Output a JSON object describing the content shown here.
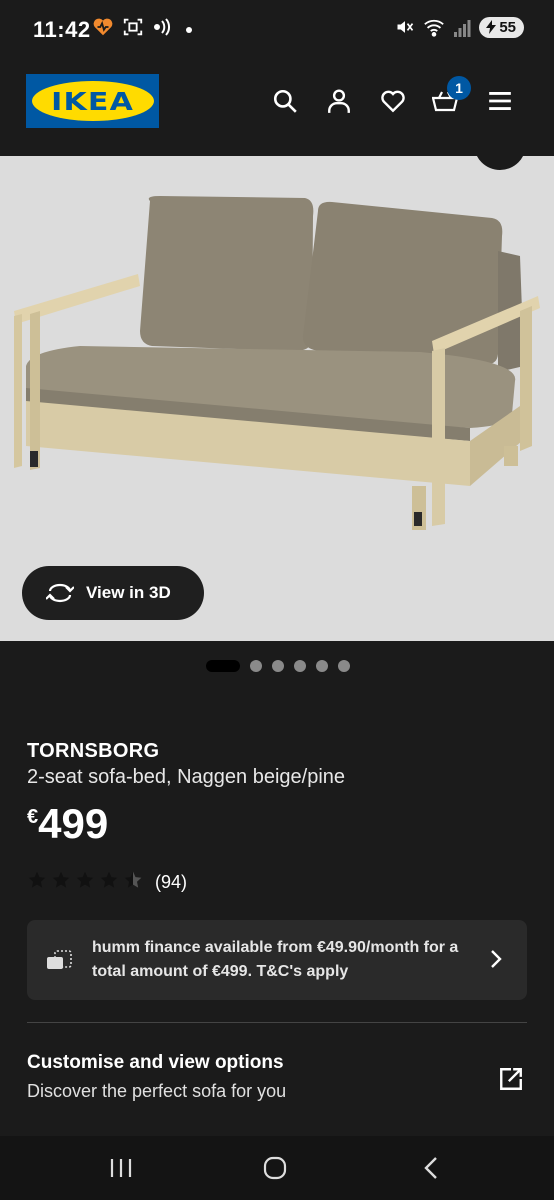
{
  "status_bar": {
    "time": "11:42",
    "battery": "55",
    "icons": [
      "heart-pulse-icon",
      "screen-capture-icon",
      "nfc-icon",
      "dot-icon",
      "mute-icon",
      "wifi-icon",
      "signal-icon",
      "battery-icon"
    ]
  },
  "header": {
    "logo_text": "IKEA",
    "cart_count": "1",
    "icons": [
      "search-icon",
      "account-icon",
      "heart-icon",
      "basket-icon",
      "menu-icon"
    ]
  },
  "hero": {
    "view_3d_label": "View in 3D",
    "carousel": {
      "total": 6,
      "active": 1
    }
  },
  "product": {
    "name": "TORNSBORG",
    "description": "2-seat sofa-bed, Naggen beige/pine",
    "currency": "€",
    "price": "499",
    "rating": 4.5,
    "rating_max": 5,
    "review_count": "(94)"
  },
  "finance": {
    "text": "humm finance available from €49.90/month for a total amount of €499. T&C's apply"
  },
  "customise": {
    "title": "Customise and view options",
    "subtitle": "Discover the perfect sofa for you"
  },
  "colors": {
    "background": "#1b1b1b",
    "ikea_blue": "#0058a3",
    "ikea_yellow": "#ffdb00",
    "image_bg": "#dcdcdc",
    "card_bg": "#2a2a2a"
  }
}
